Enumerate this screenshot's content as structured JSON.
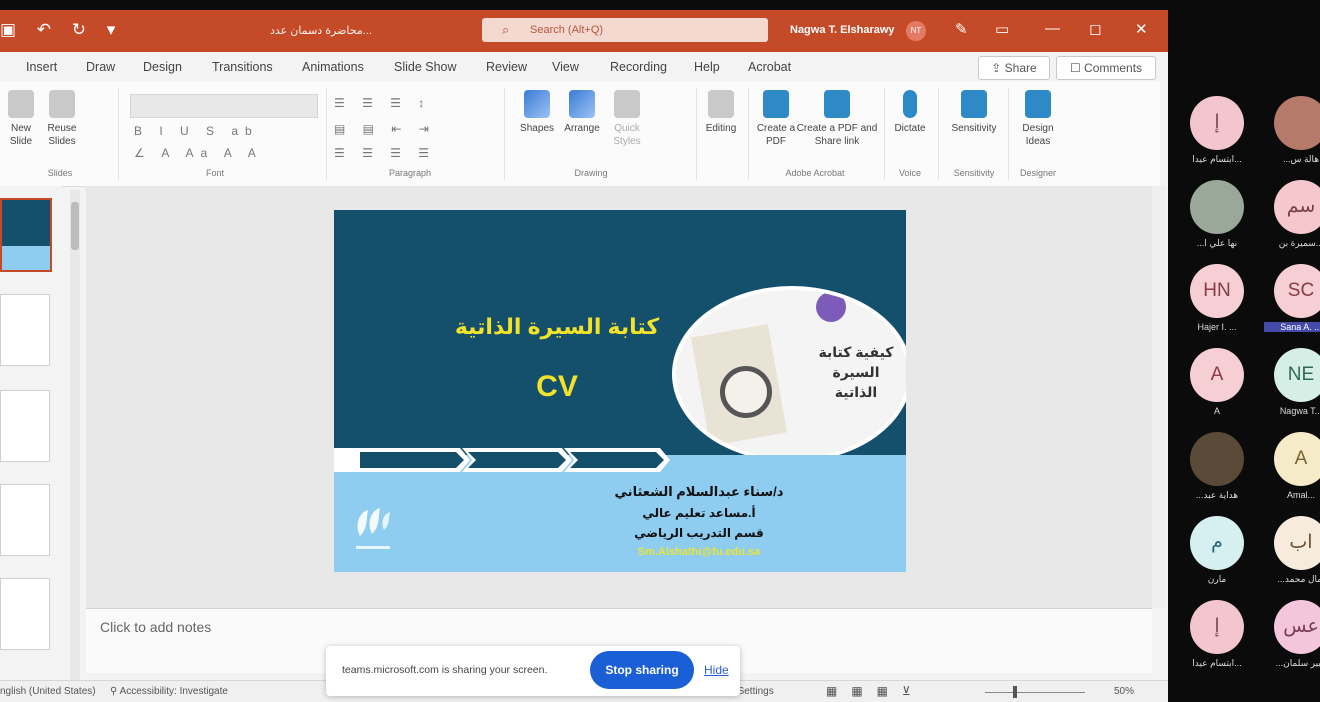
{
  "titlebar": {
    "filename": "محاضرة دسمان عدد...",
    "search_placeholder": "Search (Alt+Q)",
    "user_name": "Nagwa T. Elsharawy",
    "user_initials": "NT"
  },
  "menu": [
    "Insert",
    "Draw",
    "Design",
    "Transitions",
    "Animations",
    "Slide Show",
    "Review",
    "View",
    "Recording",
    "Help",
    "Acrobat"
  ],
  "share_label": "Share",
  "comments_label": "Comments",
  "ribbon": {
    "new_slide": "New Slide",
    "reuse_slides": "Reuse Slides",
    "shapes": "Shapes",
    "arrange": "Arrange",
    "quick_styles": "Quick Styles",
    "editing": "Editing",
    "create_pdf": "Create a PDF",
    "create_pdf_share": "Create a PDF and Share link",
    "dictate": "Dictate",
    "sensitivity": "Sensitivity",
    "design_ideas": "Design Ideas",
    "groups": {
      "slides": "Slides",
      "font": "Font",
      "paragraph": "Paragraph",
      "drawing": "Drawing",
      "adobe_acrobat": "Adobe Acrobat",
      "voice": "Voice",
      "sensitivity": "Sensitivity",
      "designer": "Designer"
    }
  },
  "slide": {
    "title": "كتابة السيرة الذاتية",
    "cv": "CV",
    "image_caption_1": "كيفية كتابة",
    "image_caption_2": "السيرة الذاتية",
    "author": "د/سناء عبدالسلام الشعثاني",
    "role": "أ.مساعد تعليم عالي",
    "department": "قسم التدريب الرياضي",
    "email": "Sm.Alshathi@fu.edu.sa"
  },
  "notes_placeholder": "Click to add notes",
  "statusbar": {
    "language": "nglish (United States)",
    "accessibility": "Accessibility: Investigate",
    "display_settings": "Display Settings",
    "zoom": "50%"
  },
  "sharebar": {
    "message": "teams.microsoft.com is sharing your screen.",
    "stop_label": "Stop sharing",
    "hide_label": "Hide"
  },
  "participants": [
    {
      "initials": "إ",
      "name": "ابتسام عيدا...",
      "bg": "#f3c6cf",
      "fg": "#7a4a52"
    },
    {
      "initials": "",
      "name": "...هالة س",
      "bg": "#b57a6a",
      "fg": "#fff"
    },
    {
      "initials": "",
      "name": "...نها علي ا",
      "bg": "#9aa89a",
      "fg": "#fff"
    },
    {
      "initials": "سم",
      "name": "سميرة بن...",
      "bg": "#f4c8cc",
      "fg": "#7a3f4a"
    },
    {
      "initials": "HN",
      "name": "Hajer I. ...",
      "bg": "#f6cfd4",
      "fg": "#8a3a4a"
    },
    {
      "initials": "SC",
      "name": "Sana A. ...",
      "bg": "#f6cfd4",
      "fg": "#8a3a4a"
    },
    {
      "initials": "A",
      "name": "A",
      "bg": "#f6cfd4",
      "fg": "#8a3a4a"
    },
    {
      "initials": "NE",
      "name": "Nagwa T...",
      "bg": "#d6efe6",
      "fg": "#2f6a55"
    },
    {
      "initials": "",
      "name": "...هداية عبد",
      "bg": "#5a4a38",
      "fg": "#fff"
    },
    {
      "initials": "A",
      "name": "Amal...",
      "bg": "#f6ebc8",
      "fg": "#7a6230"
    },
    {
      "initials": "م",
      "name": "مارن",
      "bg": "#d6f0f2",
      "fg": "#2a6a74"
    },
    {
      "initials": "اب",
      "name": "...امال محمد",
      "bg": "#f6ebdc",
      "fg": "#6a5030"
    },
    {
      "initials": "إ",
      "name": "ابتسام عيدا...",
      "bg": "#f3c6cf",
      "fg": "#7a4a52"
    },
    {
      "initials": "عس",
      "name": "...عبير سلمان",
      "bg": "#f3c6dc",
      "fg": "#7a3a5a"
    }
  ],
  "colors": {
    "titlebar": "#c54a28",
    "slide_dark": "#14506c",
    "slide_light": "#8fcdf0",
    "title_yellow": "#f2e22a",
    "stop_button": "#1b5fd6"
  }
}
